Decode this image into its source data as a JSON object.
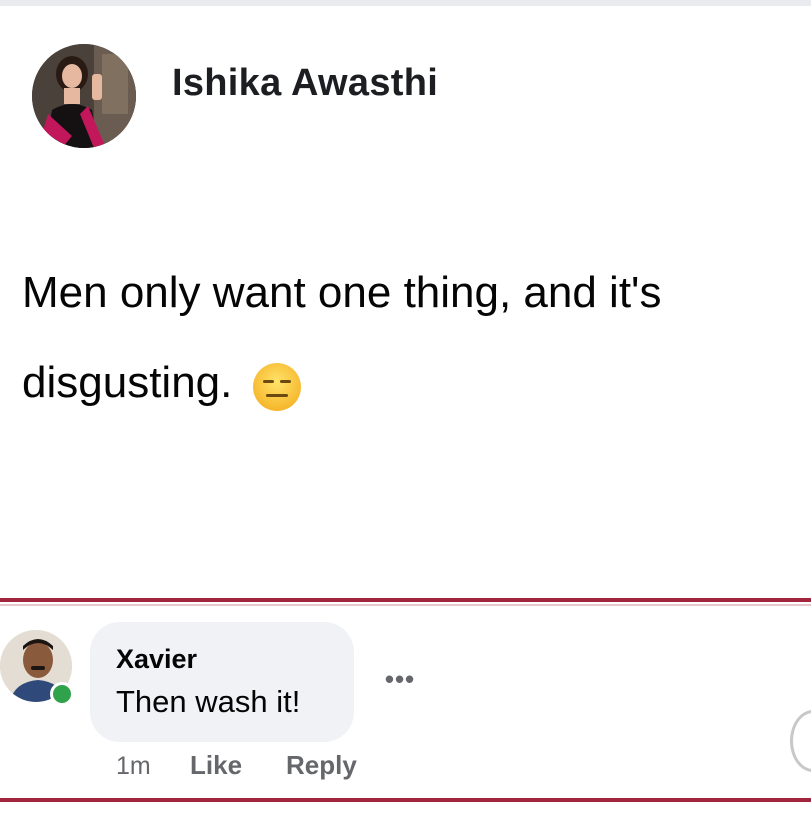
{
  "post": {
    "author": "Ishika Awasthi",
    "text": "Men only want one thing, and it's disgusting.",
    "emoji": "expressionless-face"
  },
  "comment": {
    "author": "Xavier",
    "text": "Then wash it!",
    "time": "1m",
    "like_label": "Like",
    "reply_label": "Reply",
    "more_label": "•••"
  },
  "colors": {
    "divider": "#a3243d",
    "bubble": "#f0f2f5",
    "meta": "#65676b",
    "online": "#31a24c"
  }
}
